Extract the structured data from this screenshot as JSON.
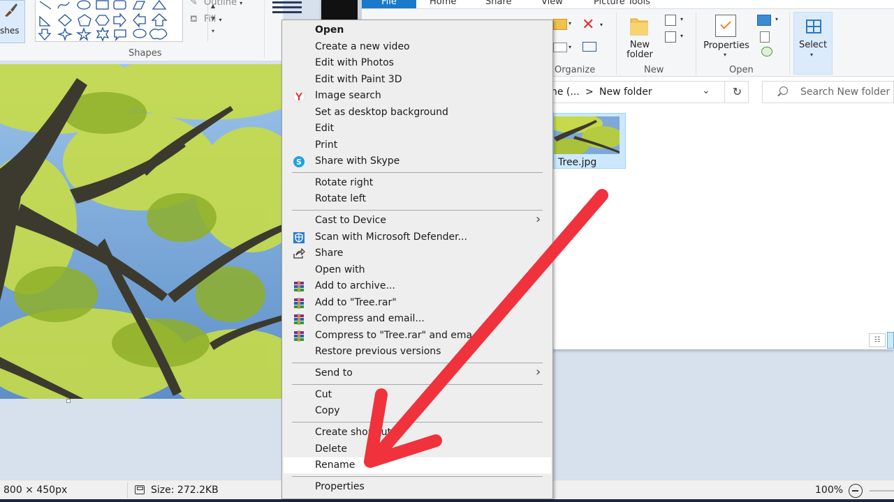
{
  "paint": {
    "ribbon": {
      "brushes_label": "shes",
      "outline_label": "Outline",
      "fill_label": "Fill",
      "shapes_group_label": "Shapes"
    },
    "status": {
      "dimensions": "800 × 450px",
      "size": "Size: 272.2KB",
      "zoom": "100%"
    }
  },
  "explorer": {
    "tabs": {
      "file": "File",
      "home": "Home",
      "share": "Share",
      "view": "View",
      "picture_tools": "Picture Tools"
    },
    "ribbon": {
      "organize_label": "Organize",
      "new_folder_line1": "New",
      "new_folder_line2": "folder",
      "new_label": "New",
      "properties_label": "Properties",
      "open_label": "Open",
      "select_label": "Select"
    },
    "address": {
      "part1": "ne (...",
      "separator": ">",
      "part2": "New folder"
    },
    "search_placeholder": "Search New folder",
    "file": {
      "name": "Tree.jpg"
    }
  },
  "context_menu": {
    "items": [
      {
        "label": "Open"
      },
      {
        "label": "Create a new video"
      },
      {
        "label": "Edit with Photos"
      },
      {
        "label": "Edit with Paint 3D"
      },
      {
        "label": "Image search"
      },
      {
        "label": "Set as desktop background"
      },
      {
        "label": "Edit"
      },
      {
        "label": "Print"
      },
      {
        "label": "Share with Skype"
      },
      {
        "label": "Rotate right"
      },
      {
        "label": "Rotate left"
      },
      {
        "label": "Cast to Device"
      },
      {
        "label": "Scan with Microsoft Defender..."
      },
      {
        "label": "Share"
      },
      {
        "label": "Open with"
      },
      {
        "label": "Add to archive..."
      },
      {
        "label": "Add to \"Tree.rar\""
      },
      {
        "label": "Compress and email..."
      },
      {
        "label": "Compress to \"Tree.rar\" and ema"
      },
      {
        "label": "Restore previous versions"
      },
      {
        "label": "Send to"
      },
      {
        "label": "Cut"
      },
      {
        "label": "Copy"
      },
      {
        "label": "Create shortcut"
      },
      {
        "label": "Delete"
      },
      {
        "label": "Rename"
      },
      {
        "label": "Properties"
      }
    ]
  },
  "colors": {
    "accent": "#1979ca",
    "annotation_arrow": "#f0323c",
    "selection": "#cce8ff"
  }
}
